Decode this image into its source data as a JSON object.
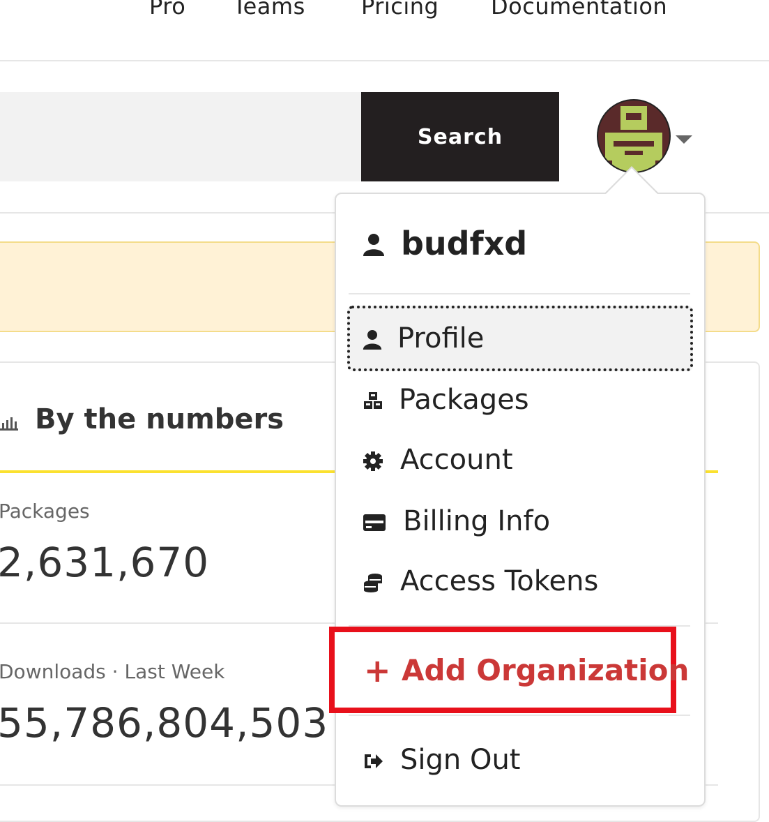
{
  "nav": {
    "links": [
      "Pro",
      "Teams",
      "Pricing",
      "Documentation"
    ]
  },
  "search": {
    "button_label": "Search",
    "input_value": ""
  },
  "stats": {
    "title": "By the numbers",
    "items": [
      {
        "label": "Packages",
        "value": "2,631,670"
      },
      {
        "label": "Downloads · Last Week",
        "value": "55,786,804,503"
      }
    ]
  },
  "user_menu": {
    "username": "budfxd",
    "items": [
      {
        "label": "Profile",
        "icon": "user-icon"
      },
      {
        "label": "Packages",
        "icon": "packages-icon"
      },
      {
        "label": "Account",
        "icon": "gear-icon"
      },
      {
        "label": "Billing Info",
        "icon": "credit-card-icon"
      },
      {
        "label": "Access Tokens",
        "icon": "coins-icon"
      }
    ],
    "add_org": {
      "label": "Add Organization",
      "icon": "plus-icon"
    },
    "sign_out": {
      "label": "Sign Out",
      "icon": "sign-out-icon"
    }
  },
  "colors": {
    "accent_red": "#cb3837",
    "highlight_border": "#e8101b",
    "yellow_line": "#fbe12f",
    "search_button": "#231f20"
  }
}
